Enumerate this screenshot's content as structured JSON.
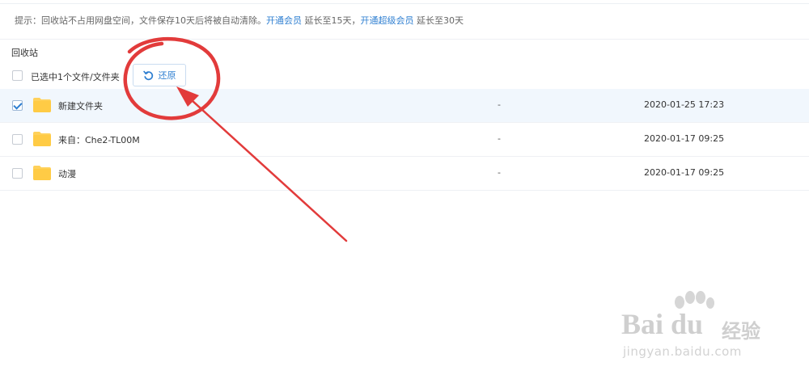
{
  "tip": {
    "prefix": "提示：回收站不占用网盘空间，文件保存10天后将被自动清除。",
    "vip_link": "开通会员",
    "vip_suffix": " 延长至15天，",
    "svip_link": "开通超级会员",
    "svip_suffix": " 延长至30天"
  },
  "section_title": "回收站",
  "toolbar": {
    "selected_text": "已选中1个文件/文件夹",
    "restore_label": "还原"
  },
  "files": [
    {
      "name": "新建文件夹",
      "size": "-",
      "date": "2020-01-25 17:23",
      "checked": true
    },
    {
      "name": "来自：Che2-TL00M",
      "size": "-",
      "date": "2020-01-17 09:25",
      "checked": false
    },
    {
      "name": "动漫",
      "size": "-",
      "date": "2020-01-17 09:25",
      "checked": false
    }
  ],
  "watermark": {
    "brand": "Bai du",
    "cn": "经验",
    "url": "jingyan.baidu.com"
  },
  "colors": {
    "link": "#2f7fd1",
    "folder": "#ffd15a",
    "selected_row": "#f1f7fd",
    "annotation": "#e23b3b"
  }
}
